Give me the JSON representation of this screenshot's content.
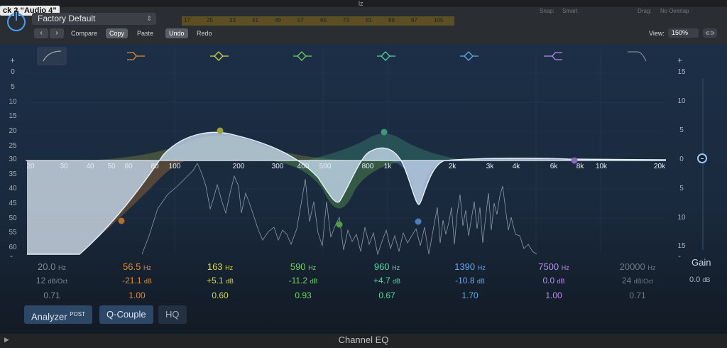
{
  "host": {
    "title": "lz",
    "track_label": "ck 2 “Audio 4”",
    "preset": "Factory Default",
    "buttons": {
      "compare": "Compare",
      "copy": "Copy",
      "paste": "Paste",
      "undo": "Undo",
      "redo": "Redo"
    },
    "snap_label": "Snap:",
    "snap_value": "Smart",
    "drag_label": "Drag:",
    "drag_value": "No Overlap",
    "ruler_marks": [
      "17",
      "25",
      "33",
      "41",
      "49",
      "57",
      "65",
      "73",
      "81",
      "89",
      "97",
      "105"
    ],
    "view_label": "View:",
    "view_value": "150%"
  },
  "db_scale_left": [
    "0",
    "5",
    "10",
    "15",
    "20",
    "25",
    "30",
    "35",
    "40",
    "45",
    "50",
    "55",
    "60"
  ],
  "db_scale_right": [
    "15",
    "10",
    "5",
    "0",
    "5",
    "10",
    "15"
  ],
  "freq_labels": [
    "20",
    "30",
    "40",
    "50",
    "60",
    "80",
    "100",
    "200",
    "300",
    "400",
    "500",
    "800",
    "1k",
    "2k",
    "3k",
    "4k",
    "6k",
    "8k",
    "10k",
    "20k"
  ],
  "bands": [
    {
      "freq": "20.0",
      "unit": "Hz",
      "gain": "12",
      "gunit": "dB/Oct",
      "q": "0.71",
      "color": "#7f8893"
    },
    {
      "freq": "56.5",
      "unit": "Hz",
      "gain": "-21.1",
      "gunit": "dB",
      "q": "1.00",
      "color": "#e58b2c"
    },
    {
      "freq": "163",
      "unit": "Hz",
      "gain": "+5.1",
      "gunit": "dB",
      "q": "0.60",
      "color": "#d4d845"
    },
    {
      "freq": "590",
      "unit": "Hz",
      "gain": "-11.2",
      "gunit": "dB",
      "q": "0.93",
      "color": "#6fd45a"
    },
    {
      "freq": "960",
      "unit": "Hz",
      "gain": "+4.7",
      "gunit": "dB",
      "q": "0.67",
      "color": "#53d6a0"
    },
    {
      "freq": "1390",
      "unit": "Hz",
      "gain": "-10.8",
      "gunit": "dB",
      "q": "1.70",
      "color": "#67a8e6"
    },
    {
      "freq": "7500",
      "unit": "Hz",
      "gain": "0.0",
      "gunit": "dB",
      "q": "1.00",
      "color": "#b88cf0"
    },
    {
      "freq": "20000",
      "unit": "Hz",
      "gain": "24",
      "gunit": "dB/Oct",
      "q": "0.71",
      "color": "#6f7882"
    }
  ],
  "gain": {
    "label": "Gain",
    "value": "0.0",
    "unit": "dB"
  },
  "modes": {
    "analyzer": "Analyzer",
    "post": "POST",
    "qcouple": "Q-Couple",
    "hq": "HQ"
  },
  "footer_title": "Channel EQ"
}
